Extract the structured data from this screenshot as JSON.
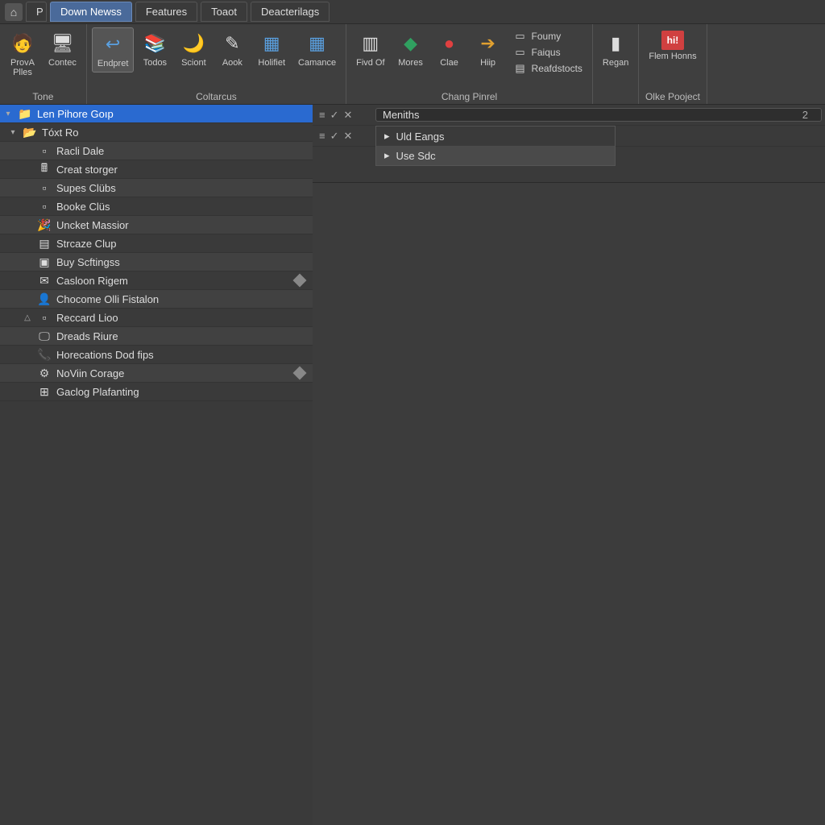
{
  "titlebar": {
    "partial_tab": "P",
    "tabs": [
      {
        "label": "Down Newss",
        "active": true
      },
      {
        "label": "Features",
        "active": false
      },
      {
        "label": "Toaot",
        "active": false
      },
      {
        "label": "Deacterilags",
        "active": false
      }
    ]
  },
  "ribbon": {
    "groups": [
      {
        "label": "Tone",
        "buttons": [
          {
            "label": "ProvA\nPlles",
            "icon": "🧑",
            "active": false
          },
          {
            "label": "Contec",
            "icon": "🖥",
            "active": false
          }
        ]
      },
      {
        "label": "Coltarcus",
        "buttons": [
          {
            "label": "Endpret",
            "icon": "↩",
            "active": true,
            "color": "#5aa0e0"
          },
          {
            "label": "Todos",
            "icon": "📚",
            "active": false
          },
          {
            "label": "Sciont",
            "icon": "🌙",
            "active": false,
            "color": "#e0a030"
          },
          {
            "label": "Aook",
            "icon": "✎",
            "active": false
          },
          {
            "label": "Holifiet",
            "icon": "▦",
            "active": false,
            "color": "#5aa0e0"
          },
          {
            "label": "Camance",
            "icon": "▦",
            "active": false,
            "color": "#5aa0e0"
          }
        ]
      },
      {
        "label": "Chang Pinrel",
        "buttons": [
          {
            "label": "Fivd Of",
            "icon": "▥",
            "active": false
          },
          {
            "label": "Mores",
            "icon": "◆",
            "active": false,
            "color": "#30a060"
          },
          {
            "label": "Clae",
            "icon": "●",
            "active": false,
            "color": "#e04040"
          },
          {
            "label": "Hiip",
            "icon": "➔",
            "active": false,
            "color": "#e0a030"
          }
        ],
        "rows": [
          {
            "icon": "▭",
            "label": "Foumy"
          },
          {
            "icon": "▭",
            "label": "Faiqus"
          },
          {
            "icon": "▤",
            "label": "Reafdstocts"
          }
        ]
      },
      {
        "label": "",
        "buttons": [
          {
            "label": "Regan",
            "icon": "▮",
            "active": false
          }
        ]
      },
      {
        "label": "Olke Pooject",
        "buttons": [
          {
            "label": "Flem Honns",
            "icon": "hi!",
            "active": false,
            "color": "#d04040"
          }
        ]
      }
    ]
  },
  "tree": {
    "items": [
      {
        "exp": "▾",
        "icon": "ic-folder",
        "label": "Len Pihore Goıp",
        "selected": true,
        "indent": 0
      },
      {
        "exp": "▾",
        "icon": "ic-folder-open",
        "label": "Tóxt Ro",
        "indent": 1
      },
      {
        "exp": "",
        "icon": "ic-page",
        "label": "Racli Dale",
        "indent": 2,
        "alt": true
      },
      {
        "exp": "",
        "icon": "ic-calc",
        "label": "Creat storger",
        "indent": 2
      },
      {
        "exp": "",
        "icon": "ic-page",
        "label": "Supes Clübs",
        "indent": 2,
        "alt": true
      },
      {
        "exp": "",
        "icon": "ic-page",
        "label": "Booke Clüs",
        "indent": 2
      },
      {
        "exp": "",
        "icon": "ic-party",
        "label": "Uncket Massior",
        "indent": 2,
        "alt": true
      },
      {
        "exp": "",
        "icon": "ic-note",
        "label": "Strcaze Clup",
        "indent": 2
      },
      {
        "exp": "",
        "icon": "ic-box",
        "label": "Buy Scftingss",
        "indent": 2,
        "alt": true
      },
      {
        "exp": "",
        "icon": "ic-mail",
        "label": "Casloon Rigem",
        "indent": 2,
        "badge": true
      },
      {
        "exp": "",
        "icon": "ic-user",
        "label": "Chocome Olli Fistalon",
        "indent": 2,
        "alt": true
      },
      {
        "exp": "△",
        "icon": "ic-page",
        "label": "Reccard Lioo",
        "indent": 2
      },
      {
        "exp": "",
        "icon": "ic-screen",
        "label": "Dreads Riure",
        "indent": 2,
        "alt": true
      },
      {
        "exp": "",
        "icon": "ic-phone",
        "label": "Horecations Dod fips",
        "indent": 2
      },
      {
        "exp": "",
        "icon": "ic-gear",
        "label": "NoViin Corage",
        "indent": 2,
        "alt": true,
        "badge": true
      },
      {
        "exp": "",
        "icon": "ic-window",
        "label": "Gaclog Plafanting",
        "indent": 2
      }
    ]
  },
  "content": {
    "header": {
      "label": "Meniths",
      "count": "2"
    },
    "dropdown": [
      {
        "icon": "▸",
        "label": "Uld Eangs"
      },
      {
        "icon": "▸",
        "label": "Use Sdc",
        "hov": true
      }
    ],
    "row_controls": {
      "a": "≡",
      "b": "✓",
      "c": "✕"
    }
  }
}
